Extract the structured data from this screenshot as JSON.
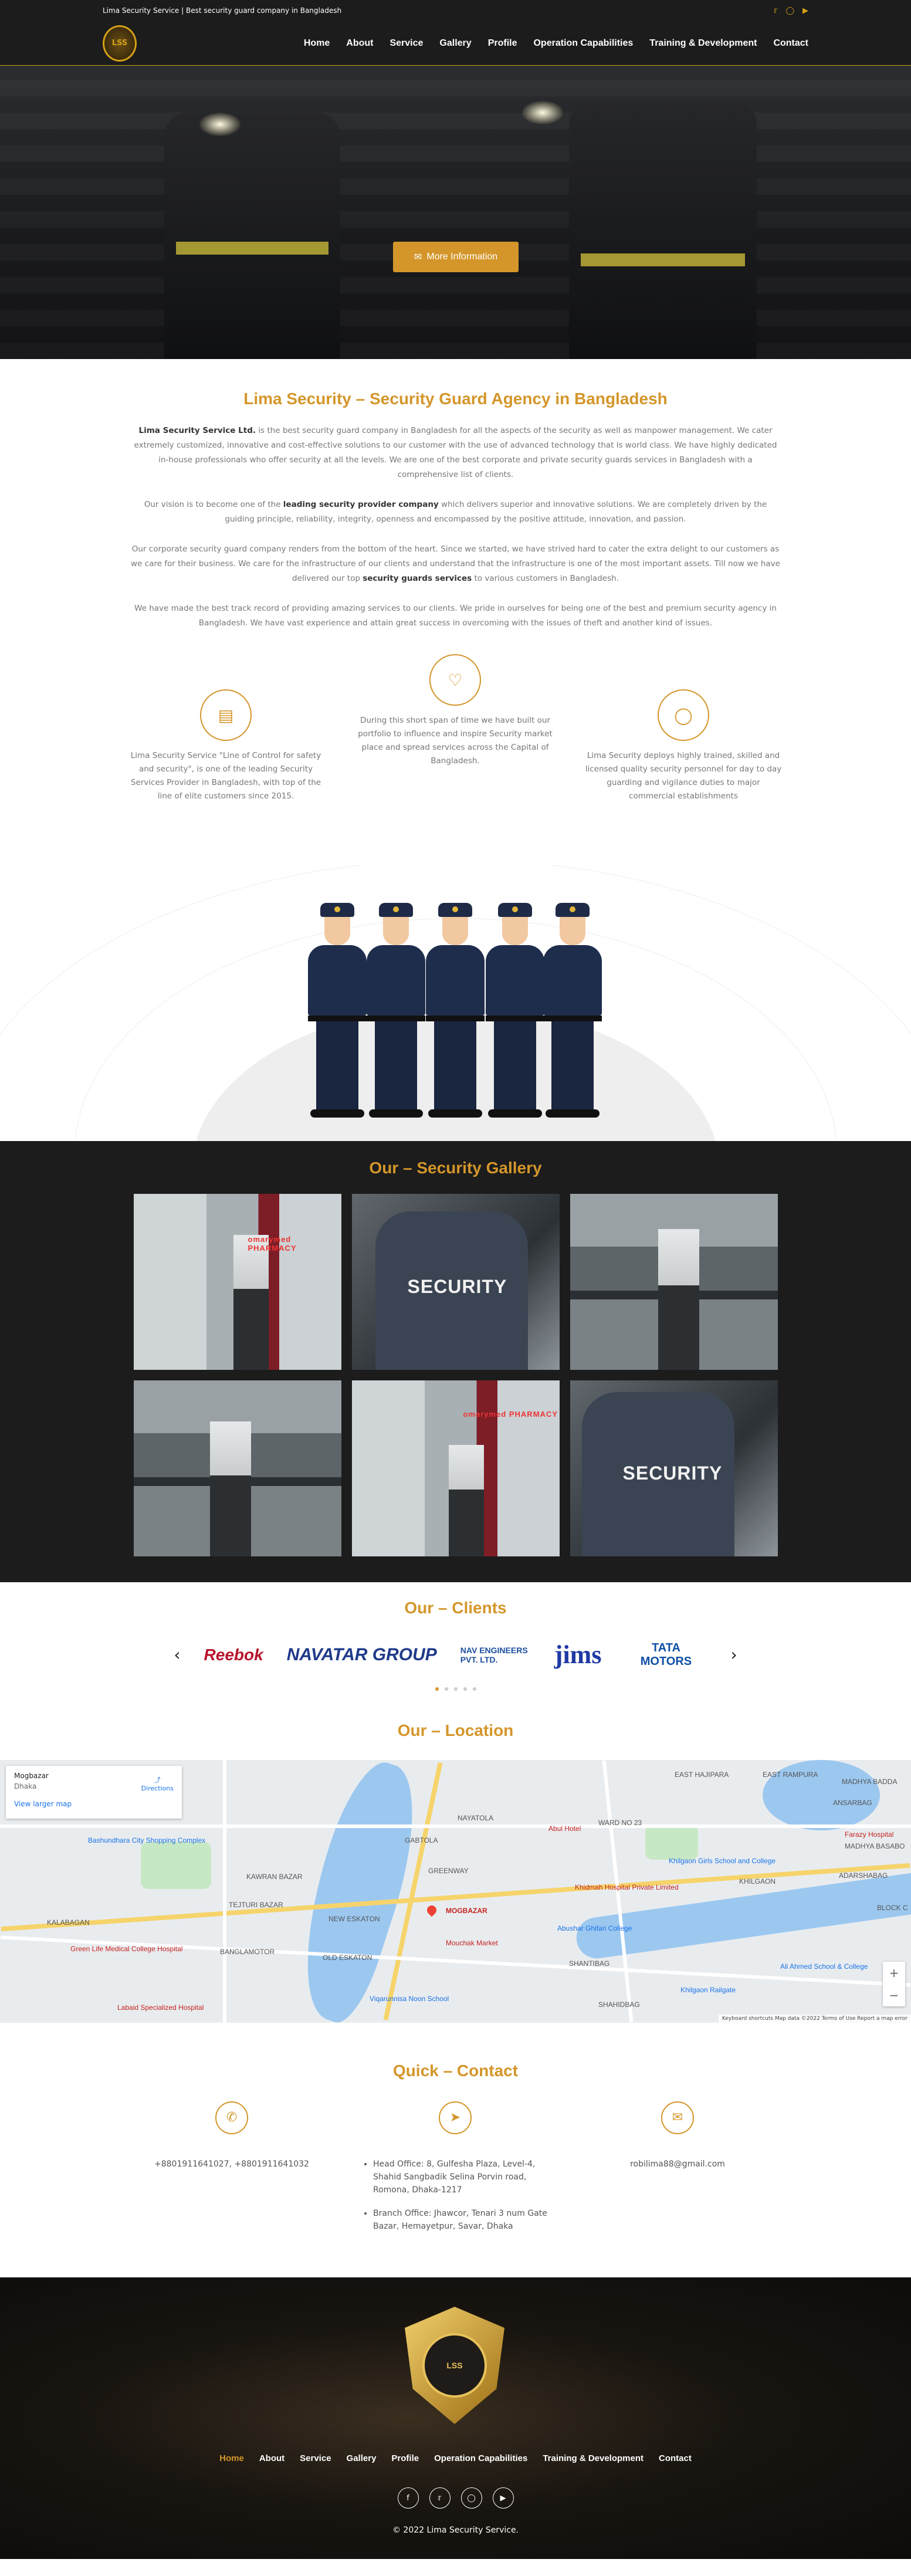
{
  "topbar": {
    "tagline": "Lima Security Service | Best security guard company in Bangladesh",
    "social": [
      "twitter-icon",
      "instagram-icon",
      "youtube-icon"
    ]
  },
  "header": {
    "logo_text": "LSS",
    "nav": [
      "Home",
      "About",
      "Service",
      "Gallery",
      "Profile",
      "Operation Capabilities",
      "Training & Development",
      "Contact"
    ]
  },
  "hero": {
    "button_label": "More Information",
    "button_icon": "envelope-icon"
  },
  "about": {
    "title_pre": "Lima Security – ",
    "title_bold": "Security Guard Agency in Bangladesh",
    "p1_bold": "Lima Security Service Ltd.",
    "p1": " is the best security guard company in Bangladesh for all the aspects of the security as well as manpower management. We cater extremely customized, innovative and cost-effective solutions to our customer with the use of advanced technology that is world class. We have highly dedicated in-house professionals who offer security at all the levels. We are one of the best corporate and private security guards services in Bangladesh with a comprehensive list of clients.",
    "p2_a": "Our vision is to become one of the ",
    "p2_bold": "leading security provider company",
    "p2_b": " which delivers superior and innovative solutions. We are completely driven by the guiding principle, reliability, integrity, openness and encompassed by the positive attitude, innovation, and passion.",
    "p3_a": "Our corporate security guard company renders from the bottom of the heart. Since we started, we have strived hard to cater the extra delight to our customers as we care for their business. We care for the infrastructure of our clients and understand that the infrastructure is one of the most important assets. Till now we have delivered our top ",
    "p3_bold": "security guards services",
    "p3_b": " to various customers in Bangladesh.",
    "p4": "We have made the best track record of providing amazing services to our clients. We pride in ourselves for being one of the best and premium security agency in Bangladesh. We have vast experience and attain great success in overcoming with the issues of theft and another kind of issues."
  },
  "features": [
    {
      "icon": "chart-icon",
      "text": "Lima Security Service \"Line of Control for safety and security\", is one of the leading Security Services Provider in Bangladesh, with top of the line of elite customers since 2015."
    },
    {
      "icon": "heart-icon",
      "text": "During this short span of time we have built our portfolio to influence and inspire Security market place and spread services across the Capital of Bangladesh."
    },
    {
      "icon": "lightbulb-icon",
      "text": "Lima Security deploys highly trained, skilled and licensed quality security personnel for day to day guarding and vigilance duties to major commercial establishments"
    }
  ],
  "gallery": {
    "title_pre": "Our – ",
    "title_bold": "Security Gallery",
    "tiles": [
      {
        "type": "pump",
        "text": "omarymed PHARMACY"
      },
      {
        "type": "back",
        "text": "SECURITY"
      },
      {
        "type": "plat",
        "text": ""
      },
      {
        "type": "plat",
        "text": ""
      },
      {
        "type": "pump",
        "text": "omarymed PHARMACY"
      },
      {
        "type": "back",
        "text": "SECURITY"
      }
    ]
  },
  "clients": {
    "title_pre": "Our – ",
    "title_bold": "Clients",
    "logos": [
      "Reebok",
      "NAVATAR GROUP",
      "NAV ENGINEERS PVT. LTD.",
      "jims",
      "TATA MOTORS"
    ],
    "prev": "‹",
    "next": "›"
  },
  "location": {
    "title_pre": "Our – ",
    "title_bold": "Location",
    "card_title": "Mogbazar",
    "card_sub": "Dhaka",
    "card_link": "View larger map",
    "directions": "Directions",
    "labels": [
      "EAST HAJIPARA",
      "EAST RAMPURA",
      "MADHYA BADDA",
      "ANSARBAG",
      "NAYATOLA",
      "GABTOLA",
      "GREENWAY",
      "KAWRAN BAZAR",
      "WARD NO 23",
      "KHILGAON",
      "SHANTIBAG",
      "MOGBAZAR",
      "NEW ESKATON",
      "OLD ESKATON",
      "BANGLAMOTOR",
      "TEJTURI BAZAR",
      "KALABAGAN",
      "SHAHIDBAG",
      "MADHYA BASABO",
      "ADARSHABAG",
      "BLOCK C"
    ],
    "places": [
      "Bashundhara City Shopping Complex",
      "Green Life Medical College Hospital",
      "Labaid Specialized Hospital",
      "Abul Hotel",
      "Khidmah Hospital Private Limited",
      "Khilgaon Girls School and College",
      "Khilgaon Railgate",
      "Abushar Ghifari College",
      "Mouchak Market",
      "Viqarunnisa Noon School",
      "Farazy Hospital",
      "Ali Ahmed School & College"
    ],
    "attribution": "Keyboard shortcuts   Map data ©2022   Terms of Use   Report a map error",
    "zoom_in": "+",
    "zoom_out": "−"
  },
  "contact": {
    "title_pre": "Quick – ",
    "title_bold": "Contact",
    "phone": "+8801911641027, +8801911641032",
    "addresses": [
      "Head Office: 8, Gulfesha Plaza, Level-4, Shahid Sangbadik Selina Porvin road, Romona, Dhaka-1217",
      "Branch Office: Jhawcor, Tenari 3 num Gate Bazar, Hemayetpur, Savar, Dhaka"
    ],
    "email": "robilima88@gmail.com"
  },
  "footer": {
    "logo_text": "LSS",
    "nav": [
      "Home",
      "About",
      "Service",
      "Gallery",
      "Profile",
      "Operation Capabilities",
      "Training & Development",
      "Contact"
    ],
    "social": [
      "facebook-icon",
      "twitter-icon",
      "instagram-icon",
      "youtube-icon"
    ],
    "copyright": "© 2022 Lima Security Service."
  },
  "colors": {
    "accent": "#d4962a",
    "dark": "#1c1c1c"
  }
}
